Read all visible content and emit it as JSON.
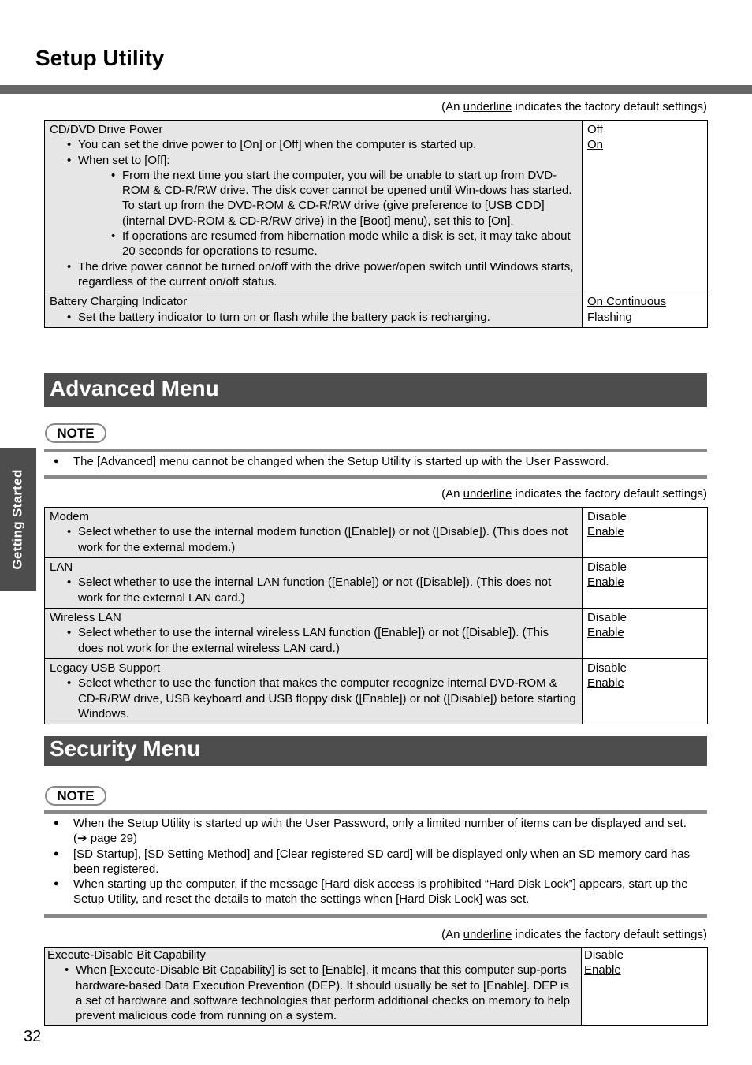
{
  "page": {
    "title": "Setup Utility",
    "side_tab": "Getting Started",
    "page_number": "32"
  },
  "legend": {
    "prefix": "(An ",
    "underlined": "underline",
    "suffix": " indicates the factory default settings)"
  },
  "main_table": {
    "rows": [
      {
        "title": "CD/DVD Drive Power",
        "bullets": [
          {
            "text": "You can set the drive power to [On] or [Off] when the computer is started up."
          },
          {
            "text": "When set to [Off]:",
            "sub": [
              "From the next time you start the computer, you will be unable to start up from DVD-ROM & CD-R/RW drive. The disk cover cannot be opened until Win-dows has started. To start up from the DVD-ROM & CD-R/RW drive (give preference to [USB CDD] (internal DVD-ROM & CD-R/RW drive) in the [Boot] menu), set this to [On].",
              "If operations are resumed from hibernation mode while a disk is set, it may take about 20 seconds for operations to resume."
            ]
          },
          {
            "text": "The drive power cannot be turned on/off with the drive power/open switch until Windows starts, regardless of the current on/off status."
          }
        ],
        "options": [
          {
            "label": "Off",
            "default": false
          },
          {
            "label": "On",
            "default": true
          }
        ]
      },
      {
        "title": "Battery Charging Indicator",
        "bullets": [
          {
            "text": "Set the battery indicator to turn on or flash while the battery pack is recharging."
          }
        ],
        "options": [
          {
            "label": "On Continuous",
            "default": true
          },
          {
            "label": "Flashing",
            "default": false
          }
        ]
      }
    ]
  },
  "advanced": {
    "header": "Advanced Menu",
    "note_label": "NOTE",
    "notes": [
      "The [Advanced] menu cannot be changed when the Setup Utility is started up with the User Password."
    ],
    "rows": [
      {
        "title": "Modem",
        "bullet": "Select whether to use the internal modem function ([Enable]) or not ([Disable]). (This does not work for the external modem.)",
        "options": [
          {
            "label": "Disable",
            "default": false
          },
          {
            "label": "Enable",
            "default": true
          }
        ]
      },
      {
        "title": "LAN",
        "bullet": "Select whether to use the internal LAN function ([Enable]) or not ([Disable]). (This does not work for the external LAN card.)",
        "options": [
          {
            "label": "Disable",
            "default": false
          },
          {
            "label": "Enable",
            "default": true
          }
        ]
      },
      {
        "title": "Wireless LAN",
        "bullet": "Select whether to use the internal wireless LAN function ([Enable]) or not ([Disable]). (This does not work for the external wireless LAN card.)",
        "options": [
          {
            "label": "Disable",
            "default": false
          },
          {
            "label": "Enable",
            "default": true
          }
        ]
      },
      {
        "title": "Legacy USB Support",
        "bullet": "Select whether to use the function that makes the computer recognize internal DVD-ROM & CD-R/RW drive, USB keyboard and USB floppy disk ([Enable]) or not ([Disable]) before starting Windows.",
        "options": [
          {
            "label": "Disable",
            "default": false
          },
          {
            "label": "Enable",
            "default": true
          }
        ]
      }
    ]
  },
  "security": {
    "header": "Security Menu",
    "note_label": "NOTE",
    "notes": [
      "When the Setup Utility is started up with the User Password, only a limited number of items can be displayed and set. (➔ page 29)",
      "[SD Startup], [SD Setting Method] and [Clear registered SD card] will be displayed only when an SD memory card has been registered.",
      "When starting up the computer, if the message [Hard disk access is prohibited “Hard Disk Lock”] appears, start up the Setup Utility, and reset the details to match the settings when [Hard Disk Lock] was set."
    ],
    "rows": [
      {
        "title": "Execute-Disable Bit Capability",
        "bullet": "When [Execute-Disable Bit Capability] is set to [Enable], it means that this computer sup-ports hardware-based Data Execution Prevention (DEP). It should usually be set to [Enable]. DEP is a set of hardware and software technologies that perform additional checks on memory to help prevent malicious code from running on a system.",
        "options": [
          {
            "label": "Disable",
            "default": false
          },
          {
            "label": "Enable",
            "default": true
          }
        ]
      }
    ]
  }
}
